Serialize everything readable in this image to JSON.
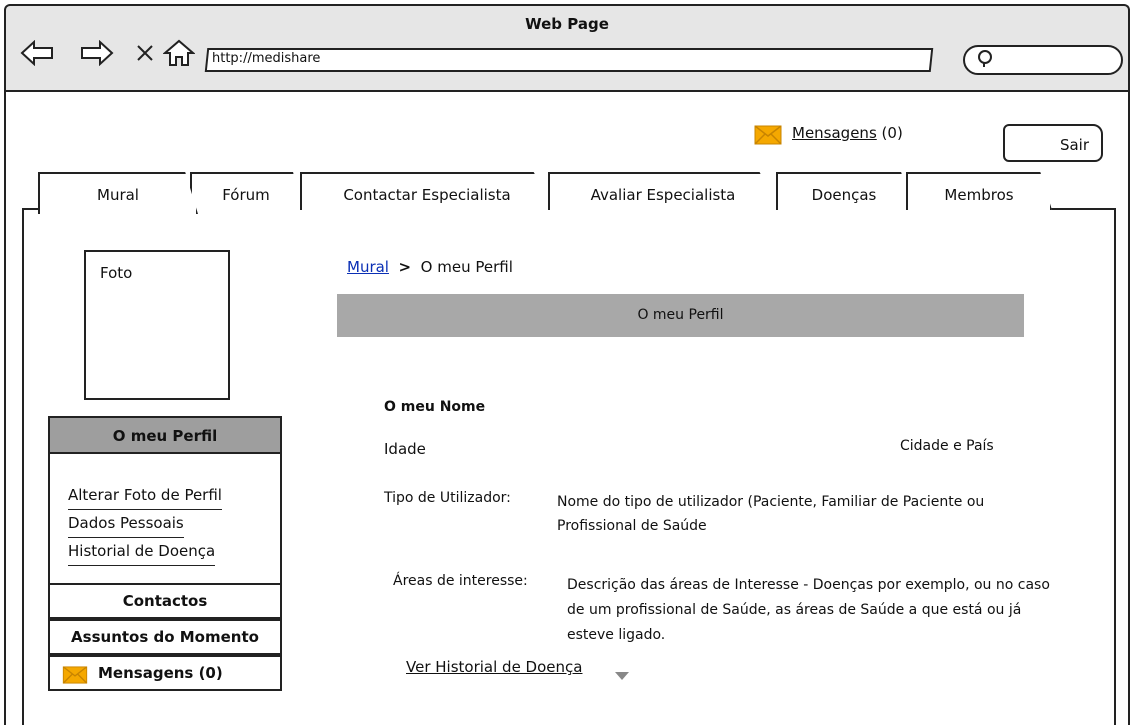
{
  "browser": {
    "title": "Web Page",
    "url": "http://medishare",
    "search_placeholder": ""
  },
  "header": {
    "messages_label": "Mensagens",
    "messages_count": "(0)",
    "logout_label": "Sair"
  },
  "tabs": [
    {
      "label": "Mural",
      "active": true
    },
    {
      "label": "Fórum",
      "active": false
    },
    {
      "label": "Contactar Especialista",
      "active": false
    },
    {
      "label": "Avaliar Especialista",
      "active": false
    },
    {
      "label": "Doenças",
      "active": false
    },
    {
      "label": "Membros",
      "active": false
    }
  ],
  "sidebar": {
    "photo_label": "Foto",
    "profile_header": "O meu Perfil",
    "links": [
      "Alterar Foto de Perfil",
      "Dados Pessoais",
      "Historial de Doença"
    ],
    "contacts": "Contactos",
    "trending": "Assuntos do Momento",
    "messages": "Mensagens (0)"
  },
  "main": {
    "breadcrumb_root": "Mural",
    "breadcrumb_sep": ">",
    "breadcrumb_current": "O meu Perfil",
    "section_title": "O meu Perfil",
    "name": "O meu Nome",
    "age": "Idade",
    "city_country": "Cidade e País",
    "user_type_label": "Tipo de Utilizador:",
    "user_type_value": "Nome do tipo de utilizador (Paciente, Familiar de Paciente ou Profissional de Saúde",
    "interests_label": "Áreas de interesse:",
    "interests_value": "Descrição das áreas de Interesse - Doenças por exemplo, ou no caso de um profissional de Saúde, as áreas de Saúde a que está ou já esteve ligado.",
    "history_link": "Ver Historial de Doença"
  },
  "colors": {
    "accent_link": "#0a2fb5",
    "section_bar": "#a8a8a8",
    "sidebar_header": "#9e9e9e",
    "mail_icon": "#f5a800"
  }
}
